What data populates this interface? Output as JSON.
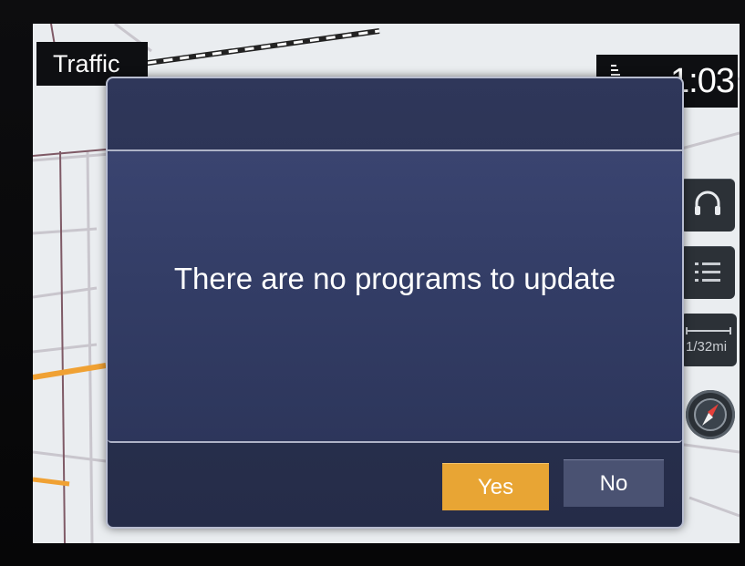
{
  "header": {
    "title": "Traffic",
    "clock": "1:03"
  },
  "map": {
    "scale_label": "1/32mi"
  },
  "dialog": {
    "message": "There are no programs to update",
    "yes_label": "Yes",
    "no_label": "No"
  },
  "side_controls": {
    "top_icon": "headset-icon",
    "menu_icon": "list-menu-icon",
    "compass_icon": "compass-icon"
  },
  "colors": {
    "dialog_bg": "#2f375a",
    "yes_button": "#e8a534",
    "no_button": "#4a5272",
    "map_bg": "#e9ecef",
    "road_orange": "#f0a133"
  }
}
